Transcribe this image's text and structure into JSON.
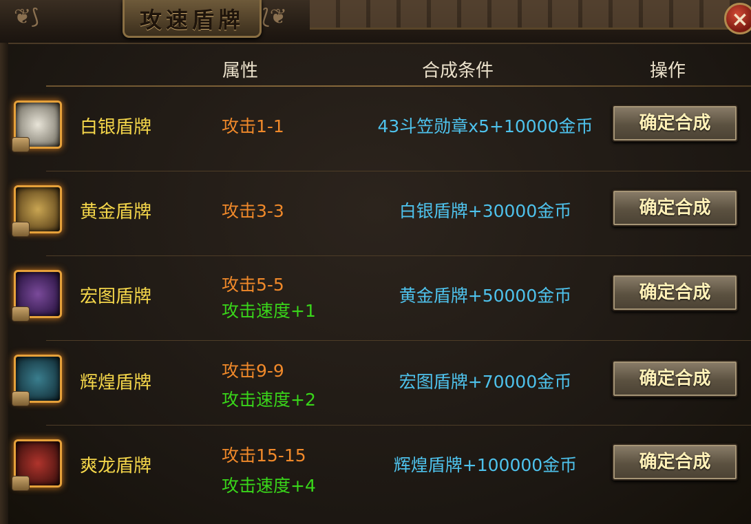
{
  "window": {
    "title": "攻速盾牌",
    "close_label": "×"
  },
  "headers": {
    "attr": "属性",
    "cond": "合成条件",
    "op": "操作"
  },
  "colors": {
    "name": "#f4d64a",
    "attack": "#f0892a",
    "speed": "#39d61a",
    "condition": "#4ec2ec"
  },
  "rows": [
    {
      "name": "白银盾牌",
      "attack": "攻击1-1",
      "speed": "",
      "condition": "43斗笠勋章x5+10000金币",
      "button": "确定合成",
      "icon": "silver-shield-icon"
    },
    {
      "name": "黄金盾牌",
      "attack": "攻击3-3",
      "speed": "",
      "condition": "白银盾牌+30000金币",
      "button": "确定合成",
      "icon": "gold-shield-icon"
    },
    {
      "name": "宏图盾牌",
      "attack": "攻击5-5",
      "speed": "攻击速度+1",
      "condition": "黄金盾牌+50000金币",
      "button": "确定合成",
      "icon": "hongtu-shield-icon"
    },
    {
      "name": "辉煌盾牌",
      "attack": "攻击9-9",
      "speed": "攻击速度+2",
      "condition": "宏图盾牌+70000金币",
      "button": "确定合成",
      "icon": "huihuang-shield-icon"
    },
    {
      "name": "爽龙盾牌",
      "attack": "攻击15-15",
      "speed": "攻击速度+4",
      "condition": "辉煌盾牌+100000金币",
      "button": "确定合成",
      "icon": "shuanglong-shield-icon"
    }
  ]
}
